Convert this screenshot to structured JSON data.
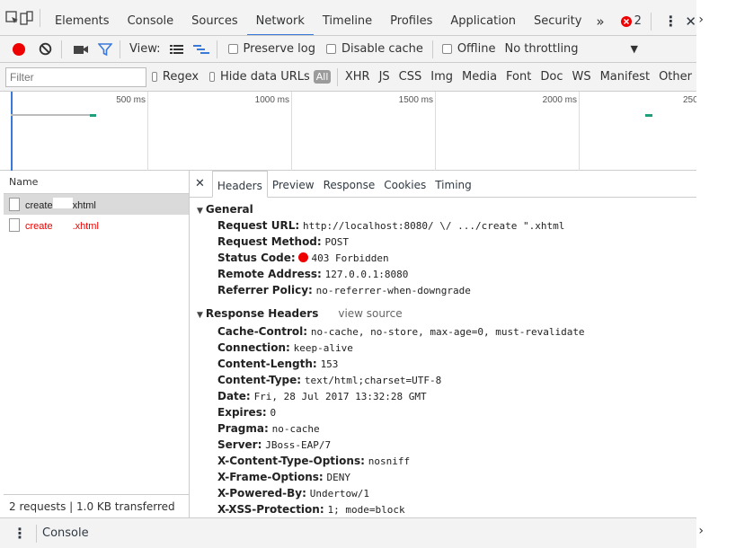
{
  "top_tabs": [
    {
      "label": "Elements"
    },
    {
      "label": "Console"
    },
    {
      "label": "Sources"
    },
    {
      "label": "Network"
    },
    {
      "label": "Timeline"
    },
    {
      "label": "Profiles"
    },
    {
      "label": "Application"
    },
    {
      "label": "Security"
    }
  ],
  "more_tabs": "»",
  "error_count": "2",
  "toolbar": {
    "view_label": "View:",
    "preserve_log": "Preserve log",
    "disable_cache": "Disable cache",
    "offline": "Offline",
    "throttling": "No throttling"
  },
  "filter": {
    "placeholder": "Filter",
    "regex": "Regex",
    "hide_data_urls": "Hide data URLs",
    "all": "All",
    "types": [
      "XHR",
      "JS",
      "CSS",
      "Img",
      "Media",
      "Font",
      "Doc",
      "WS",
      "Manifest",
      "Other"
    ]
  },
  "timeline_ticks": [
    "500 ms",
    "1000 ms",
    "1500 ms",
    "2000 ms",
    "250"
  ],
  "requests": {
    "column": "Name",
    "items": [
      {
        "prefix": "create",
        "suffix": "xhtml"
      },
      {
        "prefix": "create",
        "suffix": ".xhtml"
      }
    ],
    "summary": "2 requests  |  1.0 KB transferred"
  },
  "detail_tabs": [
    "Headers",
    "Preview",
    "Response",
    "Cookies",
    "Timing"
  ],
  "general": {
    "title": "General",
    "items": [
      {
        "key": "Request URL:",
        "value": "http://localhost:8080/   \\/ .../create  \".xhtml"
      },
      {
        "key": "Request Method:",
        "value": "POST"
      },
      {
        "key": "Status Code:",
        "value": "403 Forbidden"
      },
      {
        "key": "Remote Address:",
        "value": "127.0.0.1:8080"
      },
      {
        "key": "Referrer Policy:",
        "value": "no-referrer-when-downgrade"
      }
    ]
  },
  "response_headers": {
    "title": "Response Headers",
    "view_source": "view source",
    "items": [
      {
        "key": "Cache-Control:",
        "value": "no-cache, no-store, max-age=0, must-revalidate"
      },
      {
        "key": "Connection:",
        "value": "keep-alive"
      },
      {
        "key": "Content-Length:",
        "value": "153"
      },
      {
        "key": "Content-Type:",
        "value": "text/html;charset=UTF-8"
      },
      {
        "key": "Date:",
        "value": "Fri, 28 Jul 2017 13:32:28 GMT"
      },
      {
        "key": "Expires:",
        "value": "0"
      },
      {
        "key": "Pragma:",
        "value": "no-cache"
      },
      {
        "key": "Server:",
        "value": "JBoss-EAP/7"
      },
      {
        "key": "X-Content-Type-Options:",
        "value": "nosniff"
      },
      {
        "key": "X-Frame-Options:",
        "value": "DENY"
      },
      {
        "key": "X-Powered-By:",
        "value": "Undertow/1"
      },
      {
        "key": "X-XSS-Protection:",
        "value": "1; mode=block"
      }
    ]
  },
  "drawer": {
    "tab": "Console"
  },
  "colors": {
    "accent": "#3879d9",
    "record": "#e00",
    "error": "#e00",
    "timing": "#1e9e7a"
  }
}
